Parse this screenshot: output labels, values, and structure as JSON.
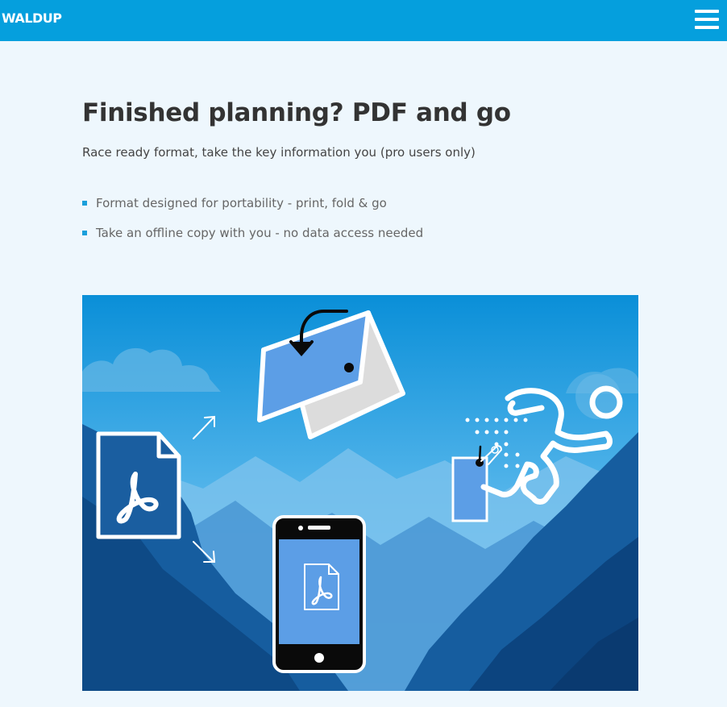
{
  "header": {
    "logo_text": "WALDUP",
    "menu_icon": "hamburger-menu-icon",
    "background_color": "#059fdd"
  },
  "main": {
    "title": "Finished planning? PDF and go",
    "subtitle": "Race ready format, take the key information you (pro users only)",
    "features": [
      "Format designed for portability - print, fold & go",
      "Take an offline copy with you - no data access needed"
    ]
  },
  "illustration": {
    "icons": [
      "pdf-document-icon",
      "folded-map-icon",
      "smartphone-pdf-icon",
      "race-bib-icon",
      "runner-icon",
      "arrow-up-right-icon",
      "arrow-down-right-icon",
      "curved-arrow-icon",
      "cloud-icon",
      "mountains-icon"
    ],
    "colors": {
      "sky_top": "#0a8fd8",
      "sky_bottom": "#9ad8f5",
      "accent_blue": "#5c9ee6",
      "mountain_dark": "#0d4d8c"
    }
  }
}
